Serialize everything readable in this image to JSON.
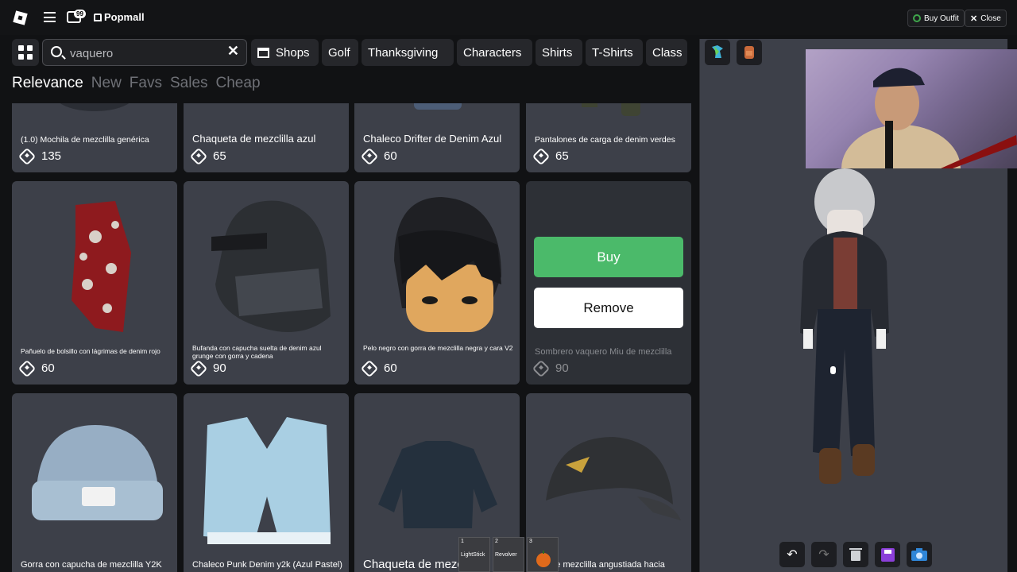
{
  "header": {
    "brand": "Popmall",
    "notification_count": "99",
    "buy_outfit_label": "Buy Outfit",
    "close_label": "Close"
  },
  "search": {
    "value": "vaquero"
  },
  "category_chips": [
    {
      "label": "Shops"
    },
    {
      "label": "Golf"
    },
    {
      "label": "Thanksgiving"
    },
    {
      "label": "Characters"
    },
    {
      "label": "Shirts"
    },
    {
      "label": "T-Shirts"
    },
    {
      "label": "Class"
    }
  ],
  "sorts": [
    {
      "label": "Relevance",
      "active": true
    },
    {
      "label": "New"
    },
    {
      "label": "Favs"
    },
    {
      "label": "Sales"
    },
    {
      "label": "Cheap"
    }
  ],
  "items": [
    {
      "name": "(1.0) Mochila de mezclilla genérica",
      "price": "135"
    },
    {
      "name": "Chaqueta de mezclilla azul",
      "price": "65"
    },
    {
      "name": "Chaleco Drifter de Denim Azul",
      "price": "60"
    },
    {
      "name": "Pantalones de carga de denim verdes",
      "price": "65"
    },
    {
      "name": "Pañuelo de bolsillo con lágrimas de denim rojo",
      "price": "60"
    },
    {
      "name": "Bufanda con capucha suelta de denim azul grunge con gorra y cadena",
      "price": "90"
    },
    {
      "name": "Pelo negro con gorra de mezclilla negra y cara V2",
      "price": "60"
    },
    {
      "name": "Sombrero vaquero Miu de mezclilla",
      "price": "90"
    },
    {
      "name": "Gorra con capucha de mezclilla Y2K",
      "price": ""
    },
    {
      "name": "Chaleco Punk Denim y2k (Azul Pastel)",
      "price": ""
    },
    {
      "name": "Chaqueta de mezclilla",
      "price": ""
    },
    {
      "name": "…a de mezclilla angustiada hacia atrás",
      "price": ""
    }
  ],
  "selected_item": {
    "buy_label": "Buy",
    "remove_label": "Remove"
  },
  "hotbar": [
    {
      "num": "1",
      "label": "LightStick"
    },
    {
      "num": "2",
      "label": "Revolver"
    },
    {
      "num": "3",
      "label": ""
    }
  ],
  "colors": {
    "buy_green": "#4bba6a",
    "card_bg": "#3d4049",
    "page_bg": "#111214"
  }
}
